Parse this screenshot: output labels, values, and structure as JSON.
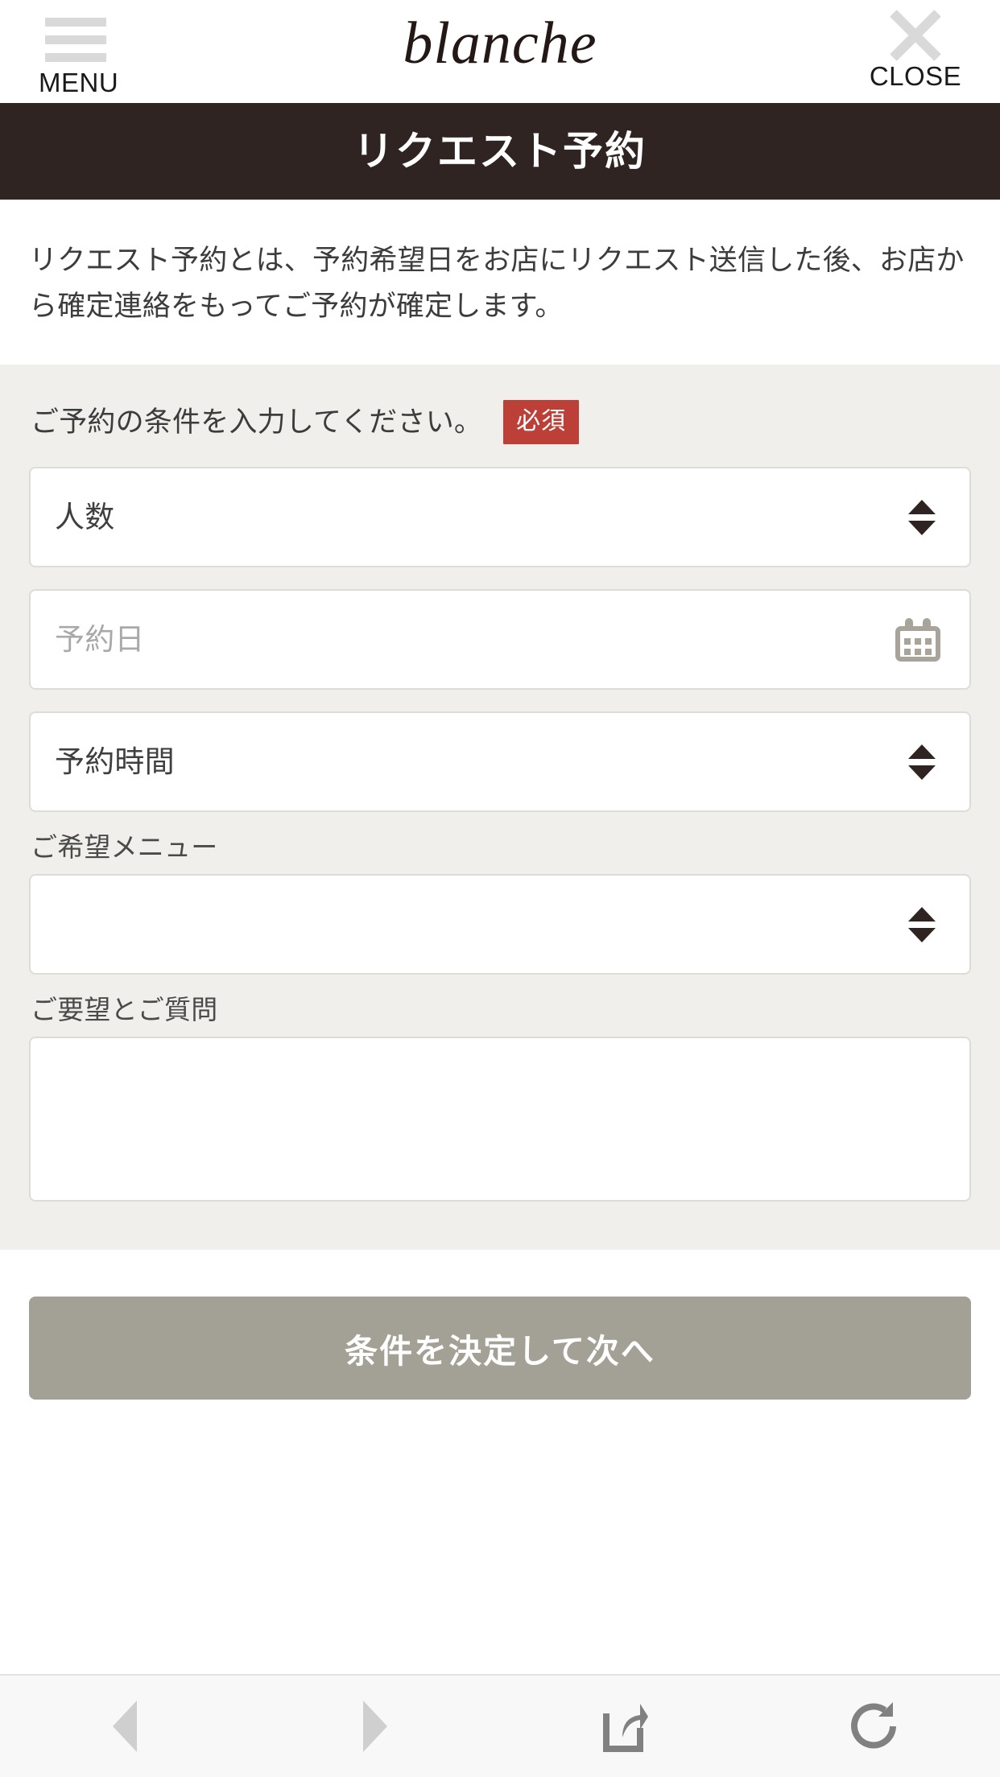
{
  "header": {
    "menu_label": "MENU",
    "brand": "blanche",
    "close_label": "CLOSE",
    "menu_icon": "hamburger-icon",
    "close_icon": "close-x-icon"
  },
  "page_title": "リクエスト予約",
  "description": "リクエスト予約とは、予約希望日をお店にリクエスト送信した後、お店から確定連絡をもってご予約が確定します。",
  "form": {
    "heading": "ご予約の条件を入力してください。",
    "required_badge": "必須",
    "fields": {
      "people": {
        "value": "人数",
        "icon": "stepper-arrows-icon"
      },
      "date": {
        "placeholder": "予約日",
        "icon": "calendar-icon"
      },
      "time": {
        "value": "予約時間",
        "icon": "stepper-arrows-icon"
      },
      "menu": {
        "label": "ご希望メニュー",
        "value": "",
        "icon": "stepper-arrows-icon"
      },
      "comment": {
        "label": "ご要望とご質問",
        "value": ""
      }
    }
  },
  "submit": {
    "label": "条件を決定して次へ"
  },
  "browser_toolbar": {
    "back_icon": "back-triangle-icon",
    "forward_icon": "forward-triangle-icon",
    "share_icon": "share-icon",
    "reload_icon": "reload-icon"
  },
  "colors": {
    "title_bar": "#2f2422",
    "required_badge": "#bd4038",
    "form_background": "#f0efeb",
    "submit_button": "#a3a095"
  }
}
